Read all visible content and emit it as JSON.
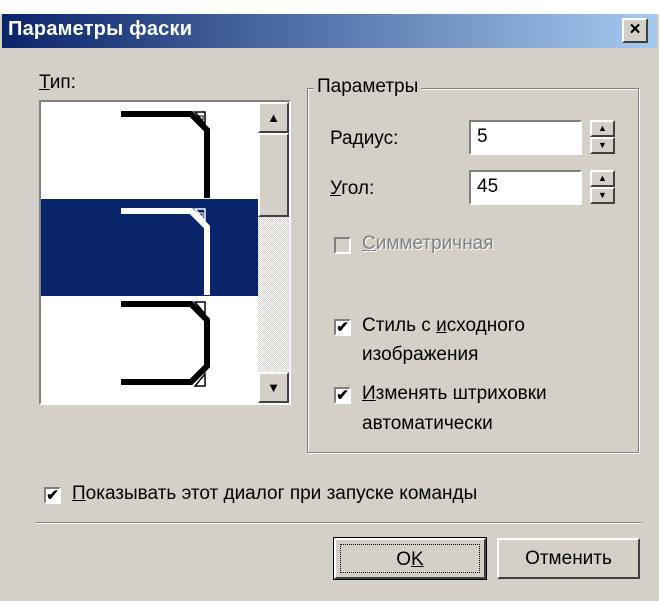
{
  "window": {
    "title": "Параметры фаски",
    "close_label": "×"
  },
  "type_section": {
    "label": "Тип:",
    "hotkey_char": "Т",
    "label_rest": "ип:"
  },
  "type_list": {
    "items": [
      {
        "name": "chamfer-type-1",
        "selected": false
      },
      {
        "name": "chamfer-type-2",
        "selected": true
      },
      {
        "name": "chamfer-type-3",
        "selected": false
      }
    ],
    "scroll_up": "▲",
    "scroll_down": "▼"
  },
  "params_group": {
    "label": "Параметры",
    "radius": {
      "label": "Радиус:",
      "value": "5"
    },
    "angle": {
      "label": "Угол:",
      "hotkey_char": "У",
      "label_rest": "гол:",
      "value": "45"
    },
    "symmetric": {
      "label": "Симметричная",
      "hotkey_char": "С",
      "label_rest": "имметричная",
      "checked": false,
      "enabled": false
    },
    "style_from_source": {
      "label_line1_pre": "Стиль с ",
      "hotkey_char": "и",
      "label_line1_post": "сходного",
      "label_line2": "изображения",
      "checked": true
    },
    "auto_hatch": {
      "hotkey_char": "И",
      "label_line1_rest": "зменять штриховки",
      "label_line2": "автоматически",
      "checked": true
    }
  },
  "show_dialog": {
    "hotkey_char": "П",
    "label_rest": "оказывать этот диалог при запуске команды",
    "checked": true
  },
  "buttons": {
    "ok_pre": "O",
    "ok_hotkey": "K",
    "cancel": "Отменить"
  },
  "colors": {
    "title_bar_start": "#0a246a",
    "title_bar_end": "#a6caf0",
    "selection": "#0a246a",
    "face": "#d4d0c8"
  },
  "check_mark": "✔"
}
